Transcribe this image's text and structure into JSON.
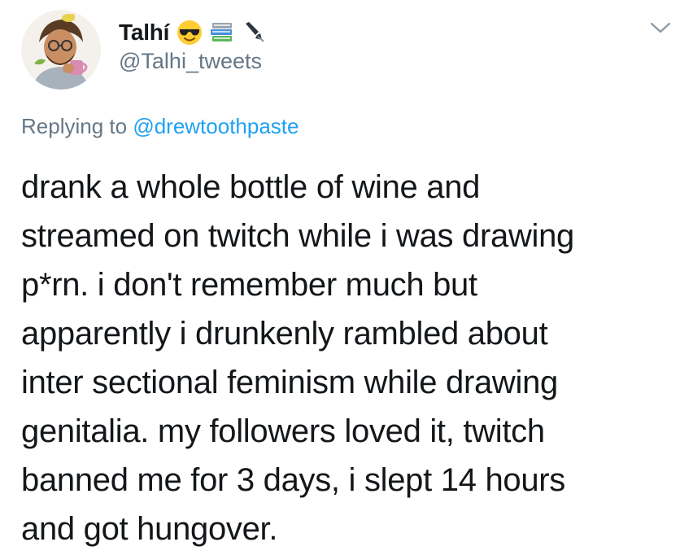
{
  "author": {
    "display_name": "Talhí",
    "handle": "@Talhi_tweets",
    "name_emojis": [
      "sunglasses-face-emoji",
      "books-emoji",
      "fountain-pen-emoji"
    ]
  },
  "reply": {
    "prefix": "Replying to",
    "mention": "@drewtoothpaste"
  },
  "tweet": {
    "lines": [
      "drank a whole bottle of wine and",
      "streamed on twitch while i was drawing",
      "p*rn. i don't remember much but",
      "apparently i drunkenly rambled about",
      "inter sectional feminism while drawing",
      "genitalia. my followers loved it, twitch",
      "banned me for 3 days, i slept 14 hours",
      "and got hungover."
    ]
  },
  "colors": {
    "text": "#14171a",
    "secondary": "#657786",
    "link": "#1da1f2",
    "background": "#ffffff"
  },
  "icons": {
    "menu": "chevron-down-icon"
  }
}
